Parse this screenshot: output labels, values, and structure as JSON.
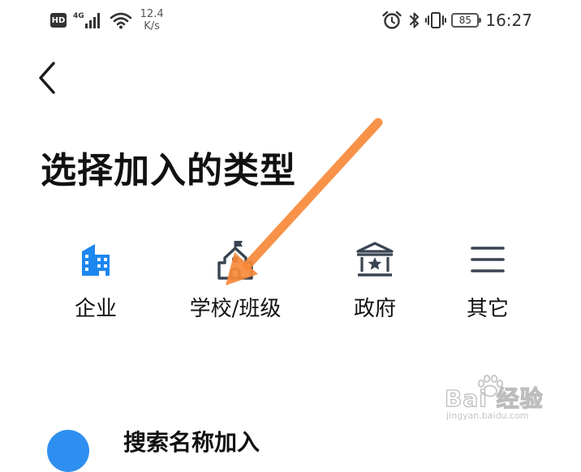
{
  "status_bar": {
    "hd": "HD",
    "network_type": "4G",
    "speed_value": "12.4",
    "speed_unit": "K/s",
    "battery": "85",
    "time": "16:27"
  },
  "page": {
    "title": "选择加入的类型"
  },
  "types": [
    {
      "label": "企业",
      "icon": "building-icon",
      "color": "#1d87f0"
    },
    {
      "label": "学校/班级",
      "icon": "school-icon",
      "color": "#3a4451"
    },
    {
      "label": "政府",
      "icon": "government-icon",
      "color": "#3a4451"
    },
    {
      "label": "其它",
      "icon": "menu-icon",
      "color": "#3a4451"
    }
  ],
  "list": {
    "item_text": "搜索名称加入"
  },
  "annotation": {
    "arrow_color": "#f7893a"
  },
  "watermark": {
    "main": "Bai 经验",
    "sub": "jingyan.baidu.com"
  }
}
